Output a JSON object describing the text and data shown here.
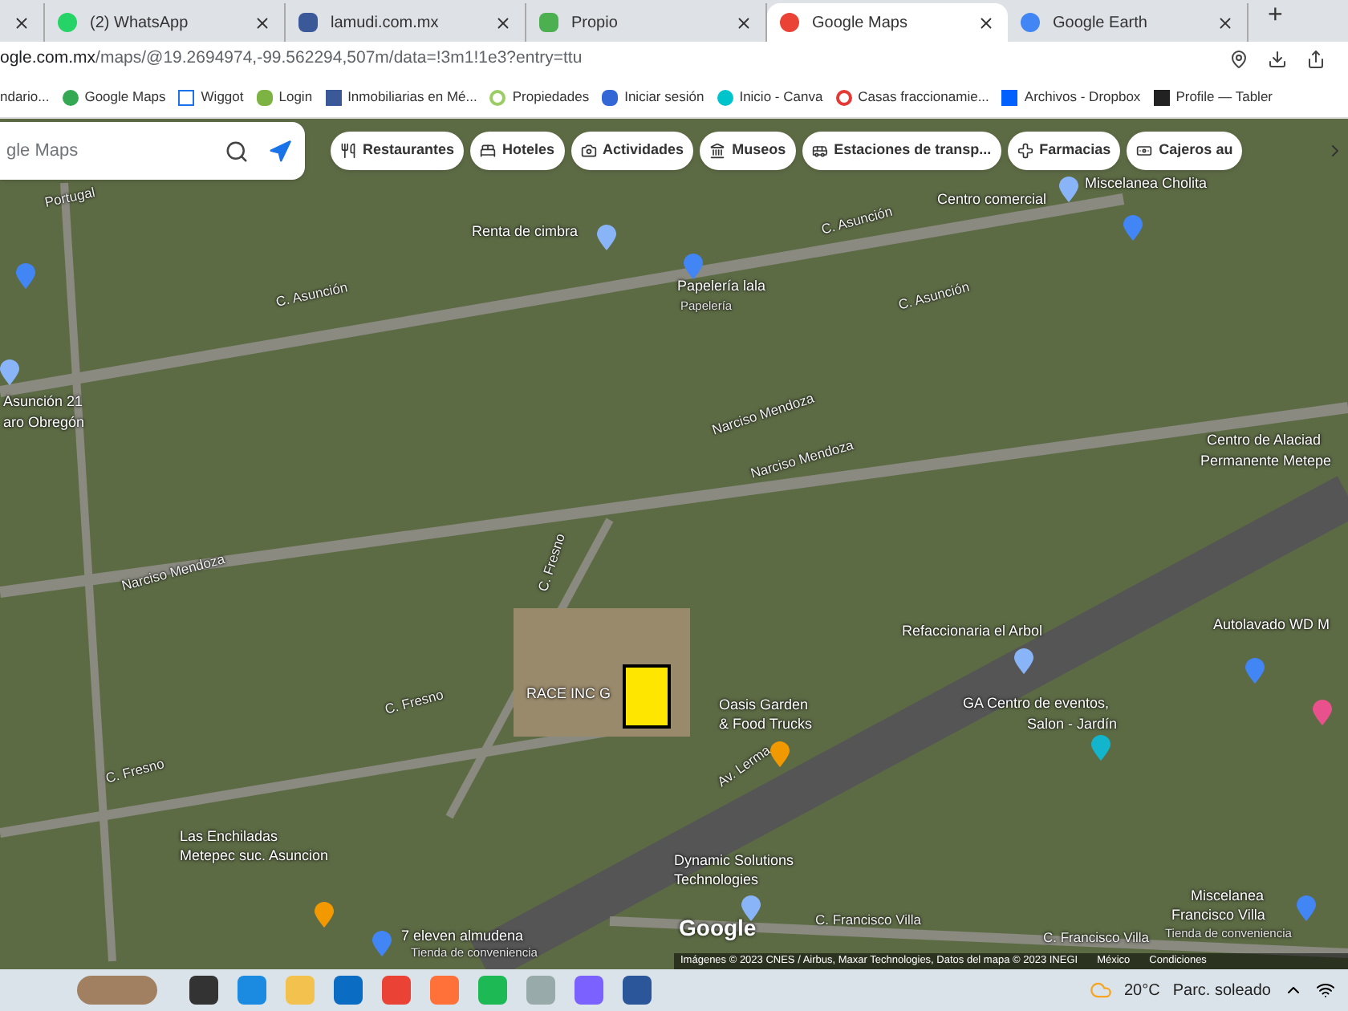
{
  "tabs": [
    {
      "selected": false
    },
    {
      "title": "(2) WhatsApp",
      "selected": false
    },
    {
      "title": "lamudi.com.mx",
      "selected": false
    },
    {
      "title": "Propio",
      "selected": false
    },
    {
      "title": "Google Maps",
      "selected": true
    },
    {
      "title": "Google Earth",
      "selected": false
    }
  ],
  "new_tab": "+",
  "address": {
    "host": "ogle.com.mx",
    "path": "/maps/@19.2694974,-99.562294,507m/data=!3m1!1e3?entry=ttu"
  },
  "bookmarks": [
    {
      "label": "ndario..."
    },
    {
      "label": "Google Maps"
    },
    {
      "label": "Wiggot"
    },
    {
      "label": "Login"
    },
    {
      "label": "Inmobiliarias en Mé..."
    },
    {
      "label": "Propiedades"
    },
    {
      "label": "Iniciar sesión"
    },
    {
      "label": "Inicio - Canva"
    },
    {
      "label": "Casas fraccionamie..."
    },
    {
      "label": "Archivos - Dropbox"
    },
    {
      "label": "Profile — Tabler"
    }
  ],
  "search": {
    "placeholder": "gle Maps"
  },
  "chips": [
    {
      "label": "Restaurantes"
    },
    {
      "label": "Hoteles"
    },
    {
      "label": "Actividades"
    },
    {
      "label": "Museos"
    },
    {
      "label": "Estaciones de transp..."
    },
    {
      "label": "Farmacias"
    },
    {
      "label": "Cajeros au"
    }
  ],
  "map_labels": [
    {
      "text": "Miscelanea Cholita",
      "kind": "place"
    },
    {
      "text": "Centro comercial",
      "kind": "place"
    },
    {
      "text": "Portugal",
      "kind": "street"
    },
    {
      "text": "Renta de cimbra",
      "kind": "place"
    },
    {
      "text": "C. Asunción",
      "kind": "street"
    },
    {
      "text": "C. Asunción",
      "kind": "street"
    },
    {
      "text": "C. Asunción",
      "kind": "street"
    },
    {
      "text": "Papelería lala",
      "kind": "place"
    },
    {
      "text": "Papelería",
      "kind": "sub"
    },
    {
      "text": "Asunción 21",
      "kind": "place"
    },
    {
      "text": "aro Obregón",
      "kind": "place"
    },
    {
      "text": "Narciso Mendoza",
      "kind": "street"
    },
    {
      "text": "Narciso Mendoza",
      "kind": "street"
    },
    {
      "text": "Narciso Mendoza",
      "kind": "street"
    },
    {
      "text": "Centro de Alaciad",
      "kind": "place"
    },
    {
      "text": "Permanente Metepe",
      "kind": "place"
    },
    {
      "text": "C. Fresno",
      "kind": "street"
    },
    {
      "text": "C. Fresno",
      "kind": "street"
    },
    {
      "text": "C. Fresno",
      "kind": "street"
    },
    {
      "text": "RACE INC G",
      "kind": "place"
    },
    {
      "text": "Refaccionaria el Arbol",
      "kind": "place"
    },
    {
      "text": "Autolavado WD M",
      "kind": "place"
    },
    {
      "text": "Oasis Garden",
      "kind": "place"
    },
    {
      "text": "& Food Trucks",
      "kind": "place"
    },
    {
      "text": "GA Centro de eventos,",
      "kind": "place"
    },
    {
      "text": "Salon - Jardín",
      "kind": "place"
    },
    {
      "text": "Av. Lerma",
      "kind": "street"
    },
    {
      "text": "Dynamic Solutions",
      "kind": "place"
    },
    {
      "text": "Technologies",
      "kind": "place"
    },
    {
      "text": "Las Enchiladas",
      "kind": "place"
    },
    {
      "text": "Metepec suc. Asuncion",
      "kind": "place"
    },
    {
      "text": "7 eleven almudena",
      "kind": "place"
    },
    {
      "text": "Tienda de conveniencia",
      "kind": "sub"
    },
    {
      "text": "C. Francisco Villa",
      "kind": "street"
    },
    {
      "text": "C. Francisco Villa",
      "kind": "street"
    },
    {
      "text": "Miscelanea",
      "kind": "place"
    },
    {
      "text": "Francisco Villa",
      "kind": "place"
    },
    {
      "text": "Tienda de conveniencia",
      "kind": "sub"
    }
  ],
  "pins": [
    {
      "color": "#8ab4f8"
    },
    {
      "color": "#8ab4f8"
    },
    {
      "color": "#4285f4"
    },
    {
      "color": "#4285f4"
    },
    {
      "color": "#4285f4"
    },
    {
      "color": "#8ab4f8"
    },
    {
      "color": "#8ab4f8"
    },
    {
      "color": "#f29900"
    },
    {
      "color": "#f29900"
    },
    {
      "color": "#12b5cb"
    },
    {
      "color": "#8ab4f8"
    },
    {
      "color": "#4285f4"
    },
    {
      "color": "#4285f4"
    },
    {
      "color": "#e8518c"
    },
    {
      "color": "#4285f4"
    }
  ],
  "logo": "Google",
  "attribution": [
    "Imágenes © 2023 CNES / Airbus, Maxar Technologies, Datos del mapa © 2023 INEGI",
    "México",
    "Condiciones"
  ],
  "taskbar": {
    "temperature": "20°C",
    "weather": "Parc. soleado"
  }
}
